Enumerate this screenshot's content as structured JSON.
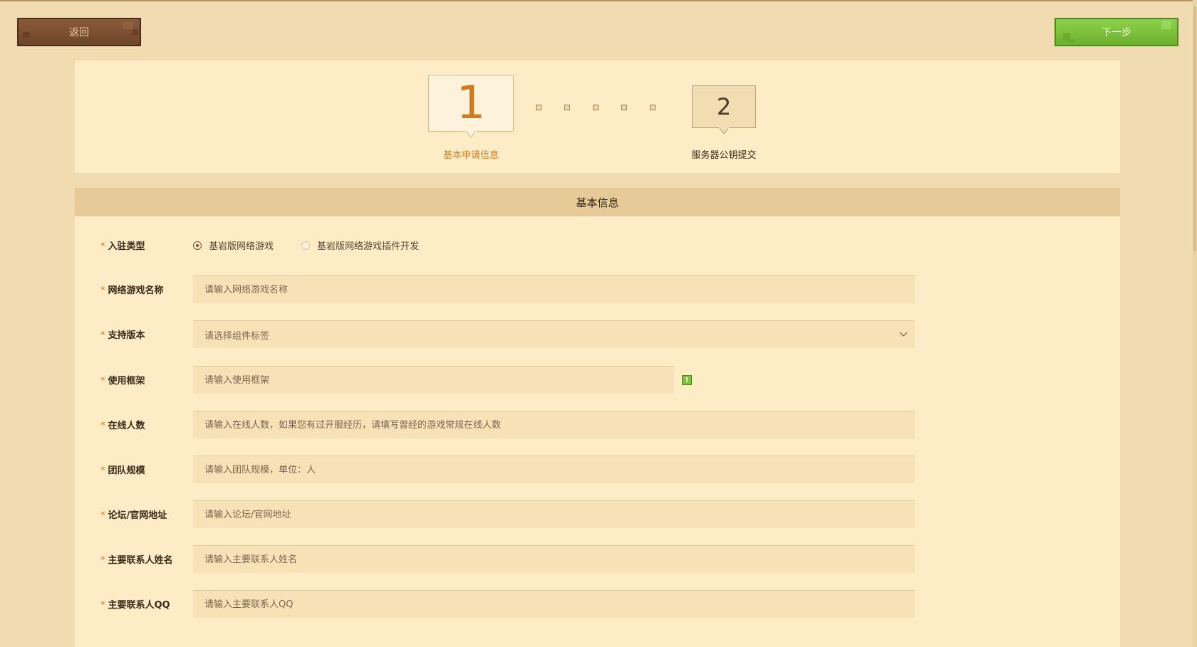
{
  "toolbar": {
    "back_label": "返回",
    "next_label": "下一步"
  },
  "steps": {
    "step1": {
      "number": "1",
      "label": "基本申请信息"
    },
    "step2": {
      "number": "2",
      "label": "服务器公钥提交"
    }
  },
  "form": {
    "header": "基本信息",
    "required_mark": "*",
    "fields": {
      "type": {
        "label": "入驻类型",
        "options": [
          "基岩版网络游戏",
          "基岩版网络游戏插件开发"
        ],
        "selected": "基岩版网络游戏"
      },
      "game_name": {
        "label": "网络游戏名称",
        "placeholder": "请输入网络游戏名称"
      },
      "version": {
        "label": "支持版本",
        "placeholder": "请选择组件标签"
      },
      "framework": {
        "label": "使用框架",
        "placeholder": "请输入使用框架",
        "icon": "!"
      },
      "online": {
        "label": "在线人数",
        "placeholder": "请输入在线人数，如果您有过开服经历，请填写曾经的游戏常规在线人数"
      },
      "team": {
        "label": "团队规模",
        "placeholder": "请输入团队规模，单位：人"
      },
      "website": {
        "label": "论坛/官网地址",
        "placeholder": "请输入论坛/官网地址"
      },
      "contact_name": {
        "label": "主要联系人姓名",
        "placeholder": "请输入主要联系人姓名"
      },
      "contact_qq": {
        "label": "主要联系人QQ",
        "placeholder": "请输入主要联系人QQ"
      }
    }
  },
  "colors": {
    "background": "#f0dcb0",
    "panel": "#fdecc6",
    "accent_orange": "#d07a1e",
    "back_brown": "#7a4d2f",
    "next_green": "#7cc23a"
  }
}
